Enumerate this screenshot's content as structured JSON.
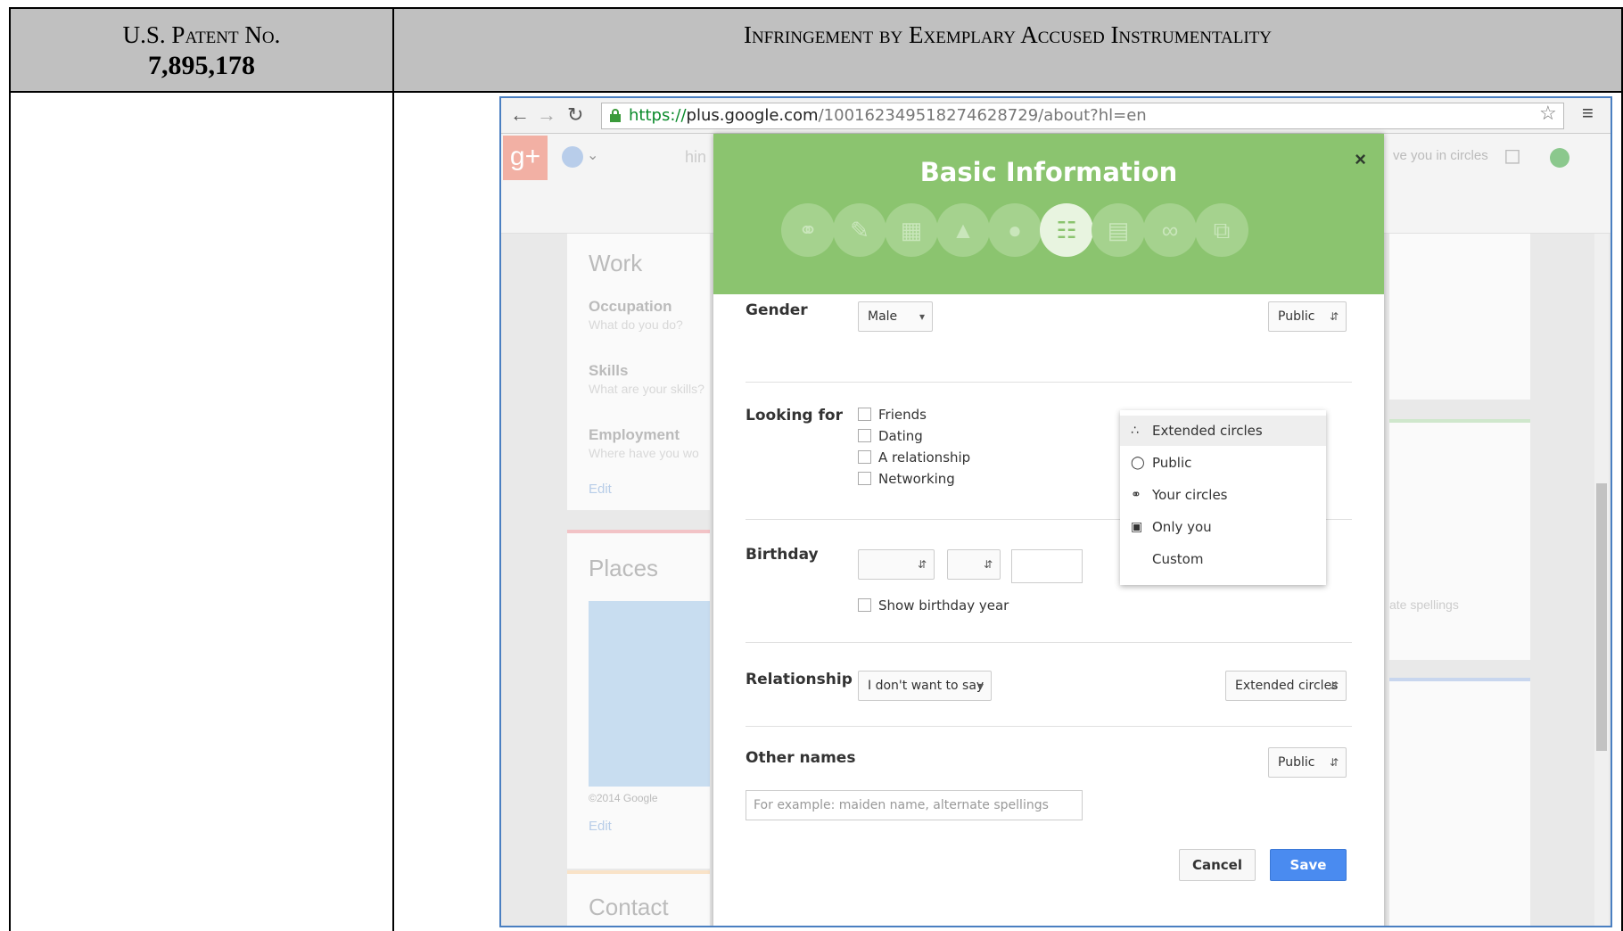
{
  "header": {
    "left_line1": "U.S. Patent No.",
    "left_line2": "7,895,178",
    "right_title": "Infringement by Exemplary Accused Instrumentality"
  },
  "browser": {
    "url_scheme": "https://",
    "url_host": "plus.google.com",
    "url_path": "/100162349518274628729/about?hl=en"
  },
  "gplus": {
    "logo": "g+",
    "search_fragment": "hin",
    "circles_fragment": "ve you in circles"
  },
  "background": {
    "work_title": "Work",
    "occupation_label": "Occupation",
    "occupation_hint": "What do you do?",
    "skills_label": "Skills",
    "skills_hint": "What are your skills?",
    "employment_label": "Employment",
    "employment_hint": "Where have you wo",
    "edit": "Edit",
    "places_title": "Places",
    "map_copyright": "©2014 Google",
    "places_edit": "Edit",
    "contact_title": "Contact Infor",
    "right_fragment": "ate spellings"
  },
  "dialog": {
    "title": "Basic Information",
    "close": "×",
    "gender_label": "Gender",
    "gender_value": "Male",
    "gender_visibility": "Public",
    "looking_label": "Looking for",
    "looking_options": [
      "Friends",
      "Dating",
      "A relationship",
      "Networking"
    ],
    "birthday_label": "Birthday",
    "show_year": "Show birthday year",
    "relationship_label": "Relationship",
    "relationship_value": "I don't want to say",
    "relationship_visibility": "Extended circles",
    "other_names_label": "Other names",
    "other_names_visibility": "Public",
    "other_names_placeholder": "For example: maiden name, alternate spellings",
    "cancel": "Cancel",
    "save": "Save"
  },
  "audience_menu": {
    "items": [
      "Extended circles",
      "Public",
      "Your circles",
      "Only you",
      "Custom"
    ],
    "highlighted": "Extended circles"
  },
  "colors": {
    "dialog_header": "#8bc46f",
    "save_button": "#4a8bf0",
    "header_cell": "#c0c0c0"
  }
}
